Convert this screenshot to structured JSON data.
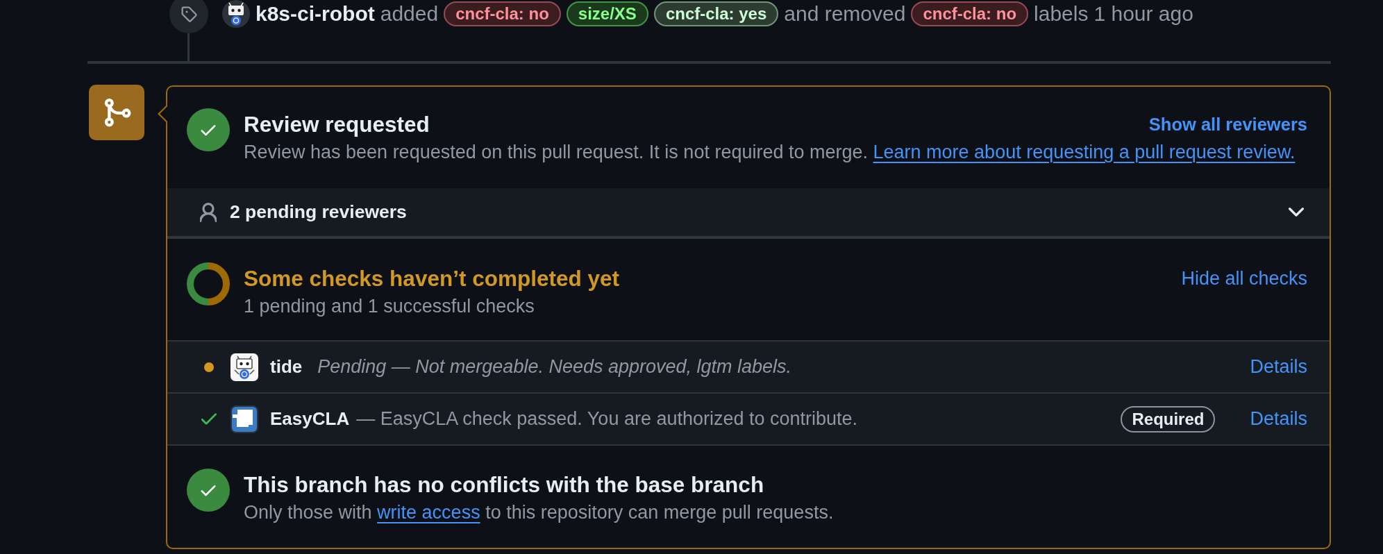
{
  "timeline_event": {
    "actor": "k8s-ci-robot",
    "added_text": "added",
    "added_labels": [
      {
        "name": "cncf-cla: no",
        "color": "#3b1d20"
      },
      {
        "name": "size/XS",
        "color": "#1a3a1b"
      },
      {
        "name": "cncf-cla: yes",
        "color": "#2d3b30"
      }
    ],
    "removed_text": "and removed",
    "removed_labels": [
      {
        "name": "cncf-cla: no",
        "color": "#3b1d20"
      }
    ],
    "suffix": "labels",
    "time": "1 hour ago"
  },
  "merge_box": {
    "review": {
      "title": "Review requested",
      "description": "Review has been requested on this pull request. It is not required to merge.",
      "link": "Learn more about requesting a pull request review.",
      "action": "Show all reviewers"
    },
    "reviewers": {
      "label": "2 pending reviewers",
      "expanded": false
    },
    "checks": {
      "title": "Some checks haven’t completed yet",
      "summary": "1 pending and 1 successful checks",
      "action": "Hide all checks",
      "items": [
        {
          "name": "tide",
          "kind": "pending",
          "description": "Pending — Not mergeable. Needs approved, lgtm labels.",
          "required": false,
          "link": "Details"
        },
        {
          "name": "EasyCLA",
          "kind": "success",
          "description": "— EasyCLA check passed. You are authorized to contribute.",
          "required": true,
          "required_label": "Required",
          "link": "Details"
        }
      ]
    },
    "merge": {
      "title": "This branch has no conflicts with the base branch",
      "text_before": "Only those with",
      "link": "write access",
      "text_after": "to this repository can merge pull requests."
    }
  }
}
